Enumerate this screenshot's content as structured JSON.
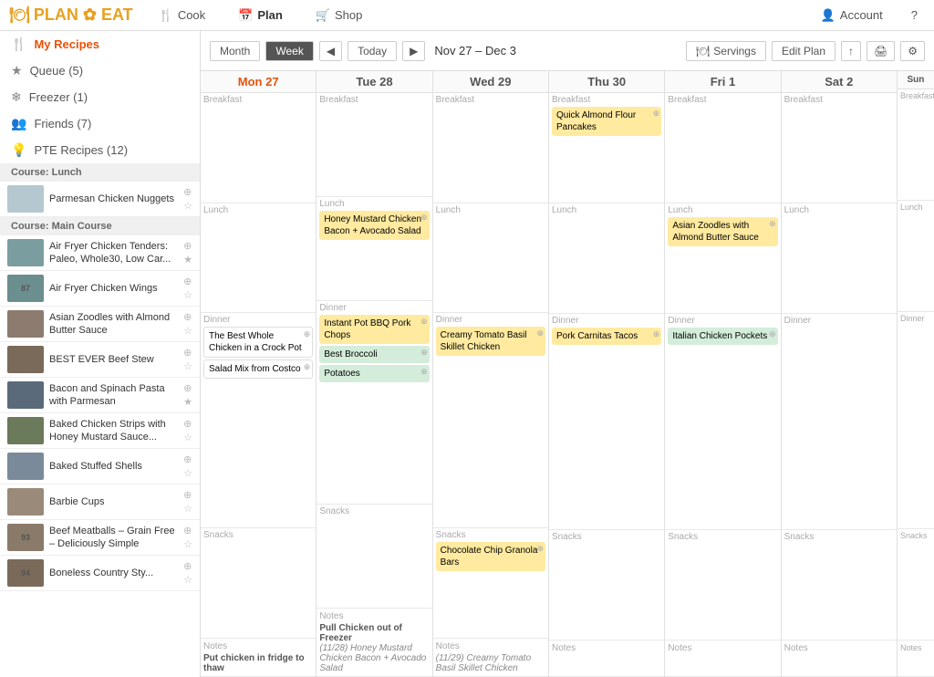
{
  "nav": {
    "logo": "PLAN TO EAT",
    "cook_label": "Cook",
    "plan_label": "Plan",
    "shop_label": "Shop",
    "account_label": "Account",
    "help_label": "?"
  },
  "sidebar": {
    "my_recipes_label": "My Recipes",
    "queue_label": "Queue (5)",
    "freezer_label": "Freezer (1)",
    "friends_label": "Friends (7)",
    "pte_label": "PTE Recipes (12)",
    "course_lunch": "Course: Lunch",
    "course_main": "Course: Main Course",
    "recipes": [
      {
        "name": "Parmesan Chicken Nuggets",
        "color": "#b5c8d0"
      },
      {
        "name": "Air Fryer Chicken Tenders: Paleo, Whole30, Low Car...",
        "color": "#7a9e9f",
        "num": ""
      },
      {
        "name": "Air Fryer Chicken Wings",
        "color": "#6b8e8e",
        "num": "87"
      },
      {
        "name": "Asian Zoodles with Almond Butter Sauce",
        "color": "#8c7b6e",
        "num": ""
      },
      {
        "name": "BEST EVER Beef Stew",
        "color": "#7a6a5a",
        "num": ""
      },
      {
        "name": "Bacon and Spinach Pasta with Parmesan",
        "color": "#5a6a7a",
        "num": ""
      },
      {
        "name": "Baked Chicken Strips with Honey Mustard Sauce...",
        "color": "#6a7a5a",
        "num": ""
      },
      {
        "name": "Baked Stuffed Shells",
        "color": "#7a8a9a",
        "num": ""
      },
      {
        "name": "Barbie Cups",
        "color": "#9a8a7a",
        "num": ""
      },
      {
        "name": "Beef Meatballs – Grain Free – Deliciously Simple",
        "color": "#8a7a6a",
        "num": "93"
      },
      {
        "name": "Boneless Country Sty...",
        "color": "#7a6a5a",
        "num": "94"
      }
    ]
  },
  "toolbar": {
    "month_label": "Month",
    "week_label": "Week",
    "prev_label": "◀",
    "today_label": "Today",
    "next_label": "▶",
    "date_range": "Nov 27 – Dec 3",
    "servings_label": "Servings",
    "edit_plan_label": "Edit Plan",
    "share_icon": "↑",
    "print_icon": "🖨",
    "settings_icon": "⚙"
  },
  "days": [
    {
      "header": "Mon 27",
      "today": true,
      "breakfast": [],
      "lunch": [],
      "dinner": [
        {
          "name": "The Best Whole Chicken in a Crock Pot",
          "style": "white"
        },
        {
          "name": "Salad Mix from Costco",
          "style": "white"
        }
      ],
      "snacks": [],
      "notes_label": "Notes",
      "notes": "Put chicken in fridge to thaw",
      "notes_sub": ""
    },
    {
      "header": "Tue 28",
      "today": false,
      "breakfast": [],
      "lunch": [
        {
          "name": "Honey Mustard Chicken Bacon + Avocado Salad",
          "style": "yellow"
        }
      ],
      "dinner": [
        {
          "name": "Instant Pot BBQ Pork Chops",
          "style": "yellow"
        },
        {
          "name": "Best Broccoli",
          "style": "green"
        },
        {
          "name": "Potatoes",
          "style": "green"
        }
      ],
      "snacks": [],
      "notes_label": "Notes",
      "notes": "Pull Chicken out of Freezer",
      "notes_sub": "(11/28) Honey Mustard Chicken Bacon + Avocado Salad"
    },
    {
      "header": "Wed 29",
      "today": false,
      "breakfast": [],
      "lunch": [],
      "dinner": [
        {
          "name": "Creamy Tomato Basil Skillet Chicken",
          "style": "yellow"
        }
      ],
      "snacks": [
        {
          "name": "Chocolate Chip Granola Bars",
          "style": "yellow"
        }
      ],
      "notes_label": "Notes",
      "notes": "",
      "notes_sub": "(11/29) Creamy Tomato Basil Skillet Chicken"
    },
    {
      "header": "Thu 30",
      "today": false,
      "breakfast": [
        {
          "name": "Quick Almond Flour Pancakes",
          "style": "yellow"
        }
      ],
      "lunch": [],
      "dinner": [
        {
          "name": "Pork Carnitas Tacos",
          "style": "yellow"
        }
      ],
      "snacks": [],
      "notes_label": "Notes",
      "notes": "",
      "notes_sub": ""
    },
    {
      "header": "Fri 1",
      "today": false,
      "breakfast": [],
      "lunch": [
        {
          "name": "Asian Zoodles with Almond Butter Sauce",
          "style": "yellow"
        }
      ],
      "dinner": [
        {
          "name": "Italian Chicken Pockets",
          "style": "green"
        }
      ],
      "snacks": [],
      "notes_label": "Notes",
      "notes": "",
      "notes_sub": ""
    },
    {
      "header": "Sat 2",
      "today": false,
      "breakfast": [],
      "lunch": [],
      "dinner": [],
      "snacks": [],
      "notes_label": "Notes",
      "notes": "",
      "notes_sub": ""
    },
    {
      "header": "Sun",
      "today": false,
      "breakfast": [],
      "lunch": [],
      "dinner": [],
      "snacks": [],
      "notes_label": "Notes",
      "notes": "",
      "notes_sub": ""
    }
  ]
}
